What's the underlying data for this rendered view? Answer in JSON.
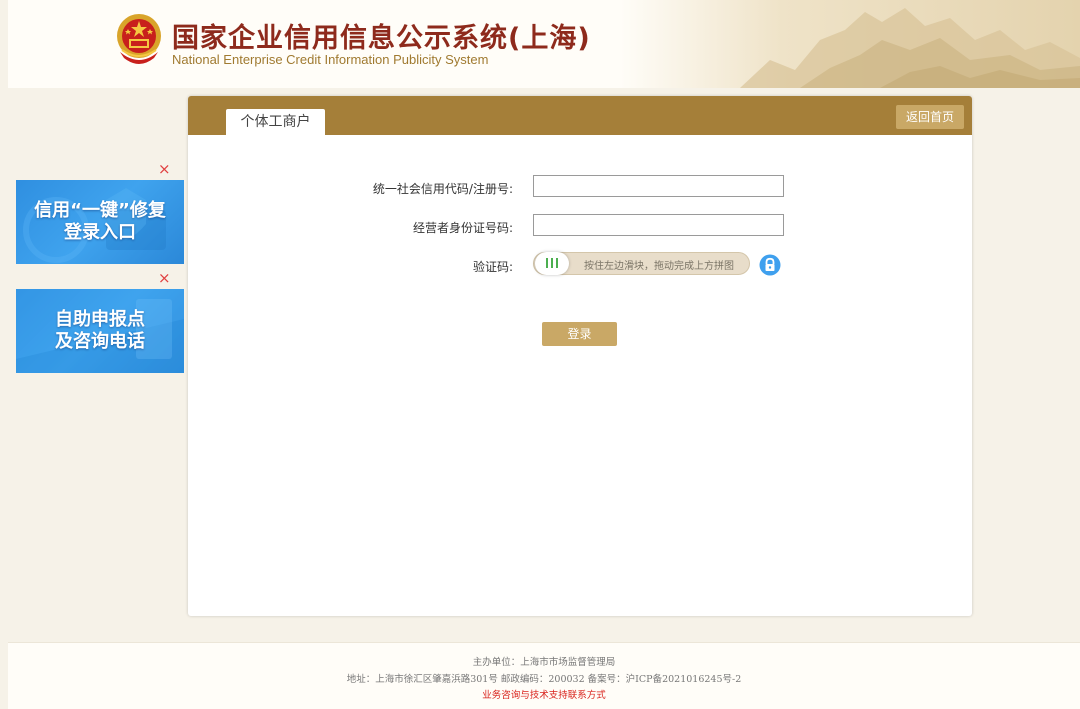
{
  "header": {
    "title": "国家企业信用信息公示系统(上海)",
    "subtitle": "National Enterprise Credit Information Publicity System"
  },
  "panel": {
    "tab_label": "个体工商户",
    "home_button": "返回首页",
    "fields": {
      "credit_code_label": "统一社会信用代码/注册号:",
      "credit_code_value": "",
      "id_number_label": "经营者身份证号码:",
      "id_number_value": "",
      "captcha_label": "验证码:"
    },
    "slider": {
      "hint": "按住左边滑块，拖动完成上方拼图",
      "handle_icon": "grip-bars-icon"
    },
    "lock_icon": "lock-icon",
    "login_button": "登录"
  },
  "ads": [
    {
      "line1": "信用“一键”修复",
      "line2": "登录入口",
      "close": "×"
    },
    {
      "line1": "自助申报点",
      "line2": "及咨询电话",
      "close": "×"
    }
  ],
  "footer": {
    "organizer": "主办单位：上海市市场监督管理局",
    "address": "地址：上海市徐汇区肇嘉浜路301号 邮政编码：200032 备案号：沪ICP备2021016245号-2",
    "contact_link": "业务咨询与技术支持联系方式"
  },
  "colors": {
    "accent_brown": "#a57f39",
    "button_gold": "#c9a866",
    "title_red": "#8e2a1c",
    "ad_blue": "#2f8fe0",
    "link_red": "#d9231c"
  }
}
